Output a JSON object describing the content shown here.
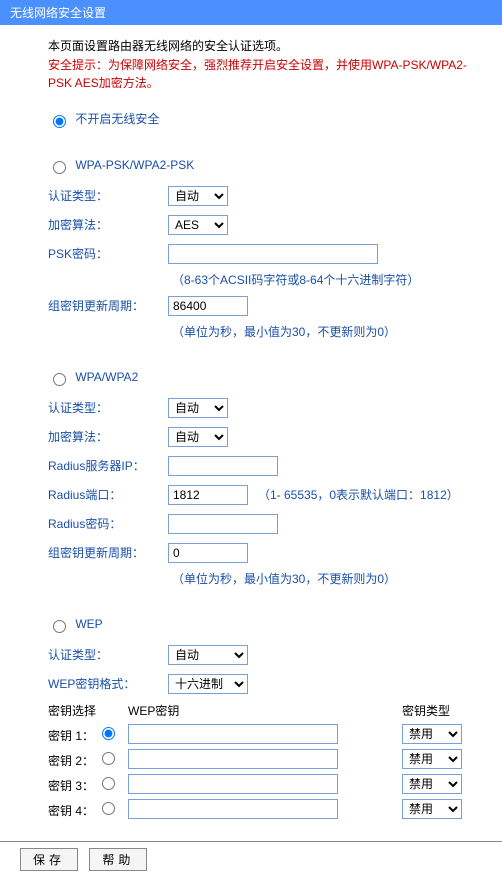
{
  "title": "无线网络安全设置",
  "description": "本页面设置路由器无线网络的安全认证选项。",
  "warning": "安全提示：为保障网络安全，强烈推荐开启安全设置，并使用WPA-PSK/WPA2-PSK AES加密方法。",
  "sections": {
    "disabled": {
      "label": "不开启无线安全"
    },
    "wpapsk": {
      "label": "WPA-PSK/WPA2-PSK",
      "auth_label": "认证类型：",
      "auth_value": "自动",
      "cipher_label": "加密算法：",
      "cipher_value": "AES",
      "psk_label": "PSK密码：",
      "psk_value": "",
      "psk_note": "（8-63个ACSII码字符或8-64个十六进制字符）",
      "rekey_label": "组密钥更新周期：",
      "rekey_value": "86400",
      "rekey_note": "（单位为秒，最小值为30，不更新则为0）"
    },
    "wpa": {
      "label": "WPA/WPA2",
      "auth_label": "认证类型：",
      "auth_value": "自动",
      "cipher_label": "加密算法：",
      "cipher_value": "自动",
      "radius_ip_label": "Radius服务器IP：",
      "radius_ip_value": "",
      "radius_port_label": "Radius端口：",
      "radius_port_value": "1812",
      "radius_port_note": "（1- 65535，0表示默认端口：1812）",
      "radius_pass_label": "Radius密码：",
      "radius_pass_value": "",
      "rekey_label": "组密钥更新周期：",
      "rekey_value": "0",
      "rekey_note": "（单位为秒，最小值为30，不更新则为0）"
    },
    "wep": {
      "label": "WEP",
      "auth_label": "认证类型：",
      "auth_value": "自动",
      "format_label": "WEP密钥格式：",
      "format_value": "十六进制",
      "header_select": "密钥选择",
      "header_key": "WEP密钥",
      "header_type": "密钥类型",
      "keys": [
        {
          "label": "密钥 1：",
          "value": "",
          "type": "禁用"
        },
        {
          "label": "密钥 2：",
          "value": "",
          "type": "禁用"
        },
        {
          "label": "密钥 3：",
          "value": "",
          "type": "禁用"
        },
        {
          "label": "密钥 4：",
          "value": "",
          "type": "禁用"
        }
      ]
    }
  },
  "buttons": {
    "save": "保存",
    "help": "帮助"
  }
}
